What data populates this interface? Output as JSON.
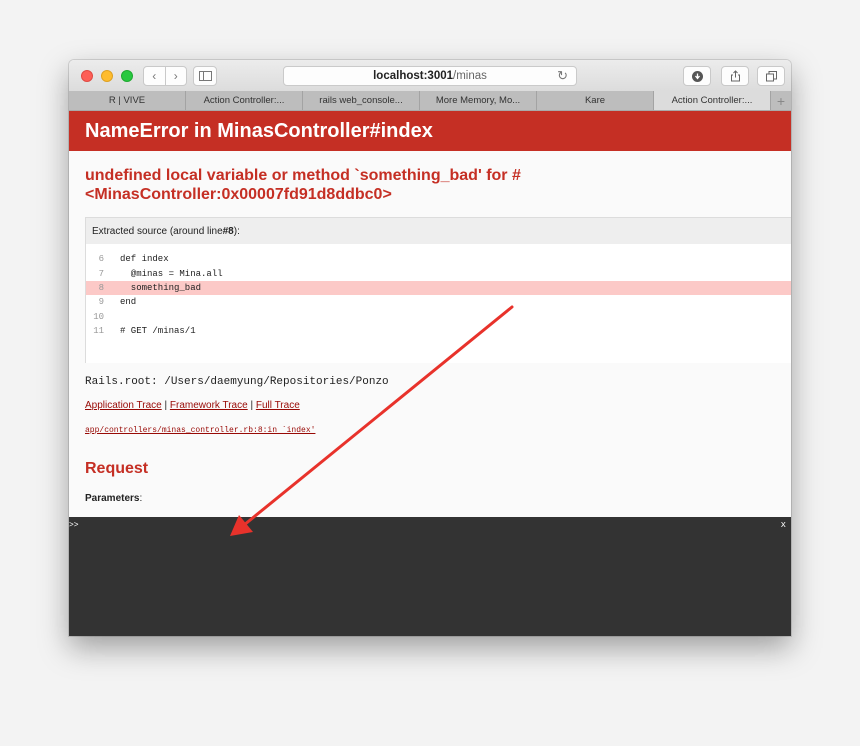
{
  "browser": {
    "url_host": "localhost:3001",
    "url_path": "/minas",
    "tabs": [
      {
        "label": "R | VIVE"
      },
      {
        "label": "Action Controller:..."
      },
      {
        "label": "rails web_console..."
      },
      {
        "label": "More Memory, Mo..."
      },
      {
        "label": "Kare"
      },
      {
        "label": "Action Controller:..."
      }
    ],
    "new_tab_label": "+"
  },
  "error": {
    "title": "NameError in MinasController#index",
    "message": "undefined local variable or method `something_bad' for #<MinasController:0x00007fd91d8ddbc0>"
  },
  "source": {
    "header_prefix": "Extracted source (around line ",
    "header_line": "#8",
    "header_suffix": "):",
    "lines": [
      {
        "num": "6",
        "code": "def index"
      },
      {
        "num": "7",
        "code": "  @minas = Mina.all"
      },
      {
        "num": "8",
        "code": "  something_bad"
      },
      {
        "num": "9",
        "code": "end"
      },
      {
        "num": "10",
        "code": ""
      },
      {
        "num": "11",
        "code": "# GET /minas/1"
      }
    ],
    "highlight_line": "8"
  },
  "rails_root": "Rails.root: /Users/daemyung/Repositories/Ponzo",
  "trace": {
    "application": "Application Trace",
    "framework": "Framework Trace",
    "full": "Full Trace",
    "separator": "|",
    "path": "app/controllers/minas_controller.rb:8:in `index'"
  },
  "request": {
    "heading": "Request",
    "params_label": "Parameters",
    "params_suffix": ":"
  },
  "console": {
    "prompt": ">>",
    "close": "x"
  },
  "colors": {
    "error_red": "#c52f24",
    "highlight": "#fcc9c7",
    "console_bg": "#333333",
    "arrow": "#e8322b"
  }
}
